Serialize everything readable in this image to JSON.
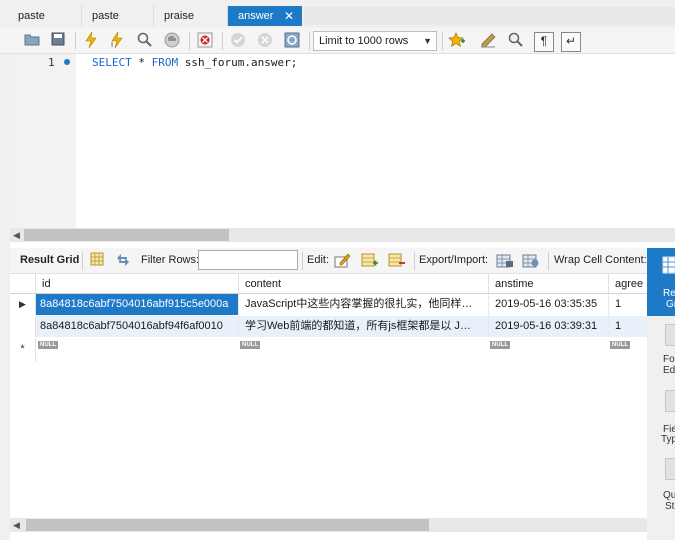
{
  "tabs": [
    {
      "label": "paste"
    },
    {
      "label": "paste"
    },
    {
      "label": "praise"
    },
    {
      "label": "answer",
      "active": true
    }
  ],
  "tab_close_glyph": "✕",
  "toolbar": {
    "icons": [
      "open-folder-icon",
      "save-icon",
      "execute-icon",
      "execute-current-icon",
      "explain-icon",
      "stop-icon",
      "toggle-error-icon",
      "commit-icon",
      "rollback-icon",
      "autocommit-icon",
      "bookmark-icon",
      "beautify-icon",
      "find-icon",
      "invisible-chars-icon",
      "wrap-icon"
    ],
    "limit_label": "Limit to 1000 rows"
  },
  "editor": {
    "line_number": "1",
    "sql": {
      "keyword1": "SELECT",
      "star": " * ",
      "keyword2": "FROM",
      "rest": " ssh_forum.answer;"
    }
  },
  "result_toolbar": {
    "result_grid": "Result Grid",
    "filter_rows": "Filter Rows:",
    "filter_value": "",
    "edit": "Edit:",
    "export_import": "Export/Import:",
    "wrap_cell": "Wrap Cell Content:"
  },
  "grid": {
    "columns": [
      "id",
      "content",
      "anstime",
      "agree"
    ],
    "rows": [
      {
        "id": "8a84818c6abf7504016abf915c5e000a",
        "content": "JavaScript中这些内容掌握的很扎实，他同样…",
        "anstime": "2019-05-16 03:35:35",
        "agree": "1",
        "selected": true
      },
      {
        "id": "8a84818c6abf7504016abf94f6af0010",
        "content": "学习Web前端的都知道，所有js框架都是以 J…",
        "anstime": "2019-05-16 03:39:31",
        "agree": "1",
        "selected": false
      }
    ],
    "null_label": "NULL",
    "new_row_marker": "*",
    "current_row_marker": "▶"
  },
  "side_panel": {
    "items": [
      {
        "label": "Re",
        "label2": "Gr"
      },
      {
        "label": "Fo",
        "label2": "Ed"
      },
      {
        "label": "Fie",
        "label2": "Typ"
      },
      {
        "label": "Qu",
        "label2": "St"
      }
    ]
  },
  "colors": {
    "accent": "#1e7ac6",
    "keyword": "#1e64d0",
    "selected_row": "#1e7ac6"
  }
}
